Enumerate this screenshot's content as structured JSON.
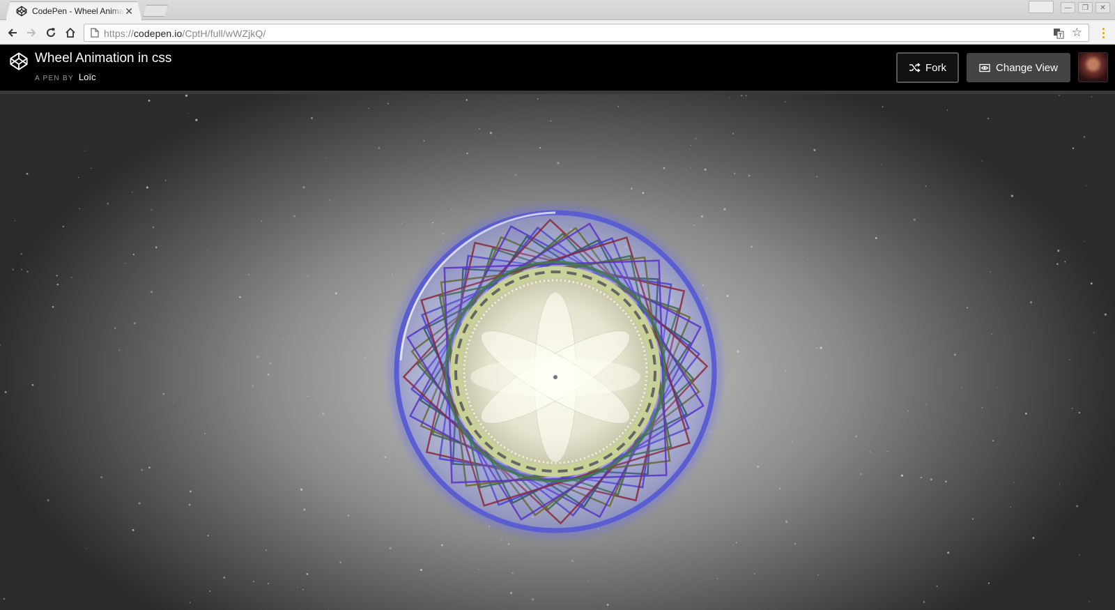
{
  "browser": {
    "tab_title": "CodePen - Wheel Animation in css",
    "tab_close": "✕",
    "url_scheme": "https://",
    "url_host": "codepen.io",
    "url_path": "/CptH/full/wWZjkQ/",
    "window_controls": {
      "minimize": "—",
      "maximize": "❐",
      "close": "✕"
    },
    "star": "☆"
  },
  "header": {
    "title": "Wheel Animation in css",
    "byline_prefix": "A PEN BY",
    "author": "Loïc",
    "fork_label": "Fork",
    "change_view_label": "Change View"
  },
  "icons": {
    "logo": "codepen-logo-icon",
    "fork": "fork-icon",
    "change_view": "eye-icon",
    "back": "back-arrow-icon",
    "forward": "forward-arrow-icon",
    "reload": "reload-icon",
    "home": "home-icon",
    "translate": "translate-icon",
    "bookmark": "star-icon",
    "menu": "menu-dots-icon"
  },
  "colors": {
    "header_bg": "#000000",
    "button_bg": "#444444",
    "wheel_rim": "#5a5ed0",
    "hub_fill": "#ecebd6",
    "hub_ring": "#c9d196"
  }
}
